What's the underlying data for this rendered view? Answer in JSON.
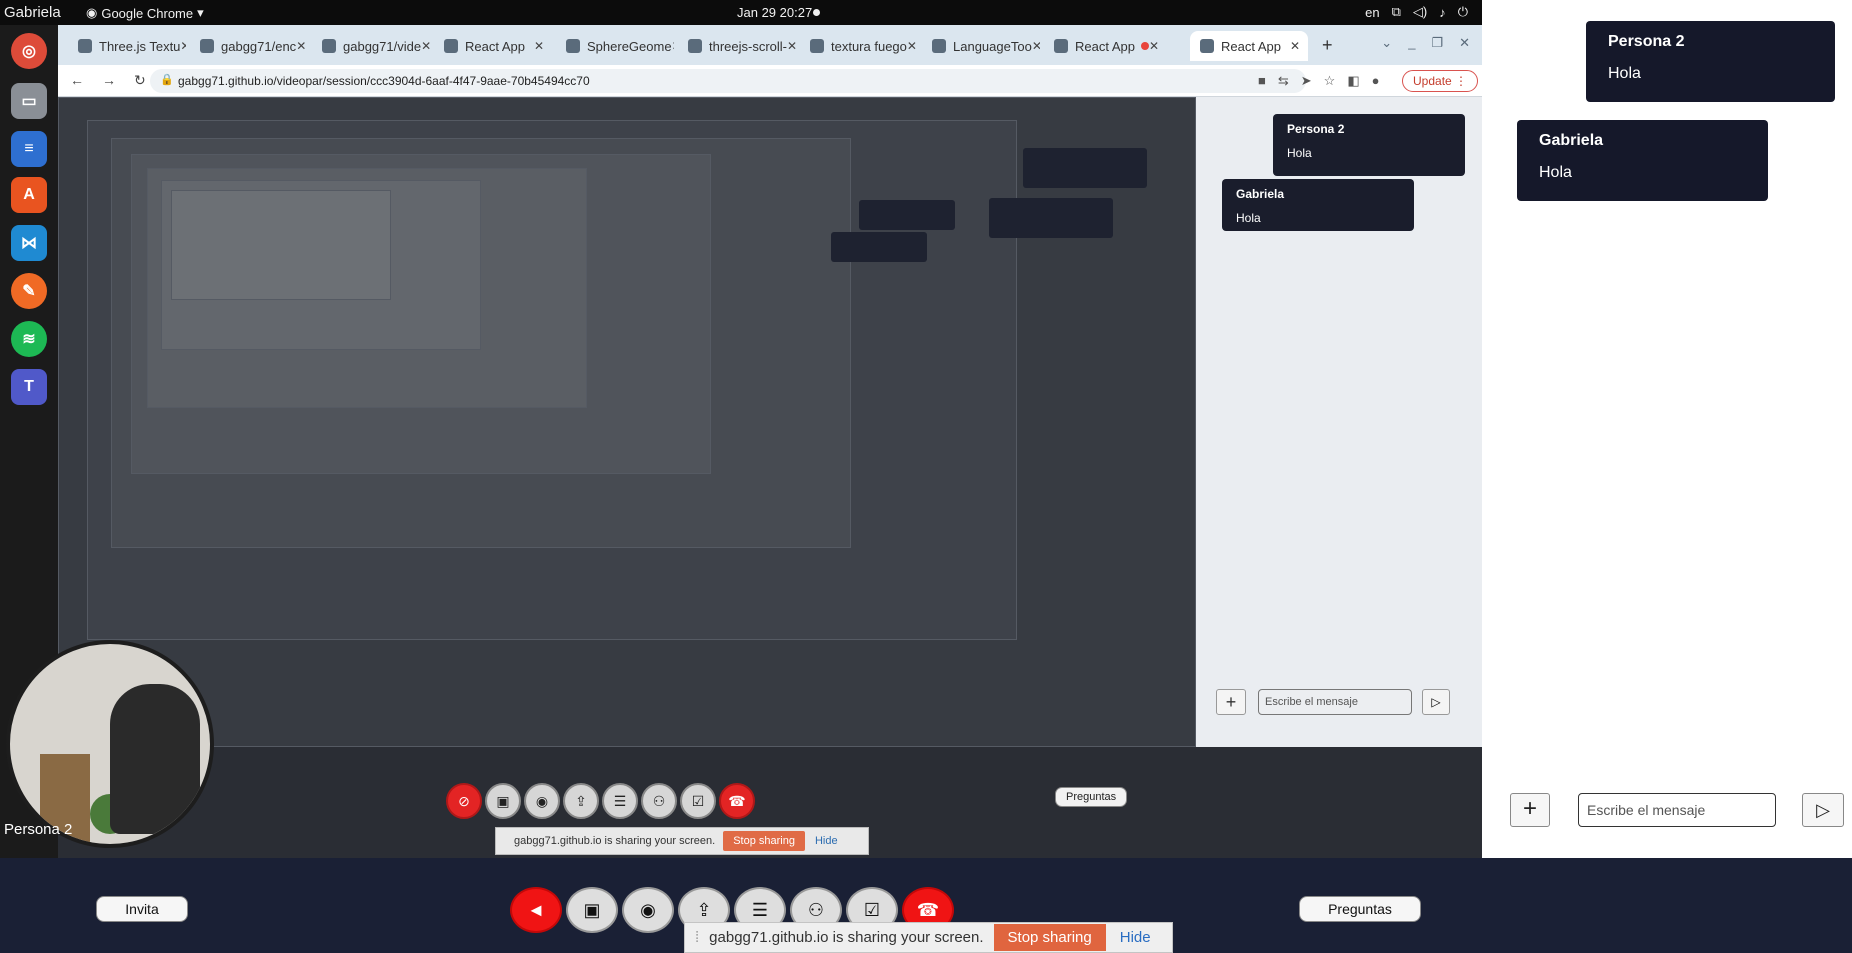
{
  "os_bar": {
    "user": "Gabriela",
    "app_menu": "Google Chrome",
    "clock": "Jan 29  20:27",
    "language": "en"
  },
  "dock": {
    "apps": [
      {
        "name": "chrome-icon",
        "color": "#dd4b39"
      },
      {
        "name": "files-icon",
        "color": "#8a8f96"
      },
      {
        "name": "document-icon",
        "color": "#2e6fd0"
      },
      {
        "name": "app-store-icon",
        "color": "#e95420"
      },
      {
        "name": "vscode-icon",
        "color": "#1f8ad2"
      },
      {
        "name": "drawing-icon",
        "color": "#f06a25"
      },
      {
        "name": "spotify-icon",
        "color": "#1db954"
      },
      {
        "name": "teams-icon",
        "color": "#5059c9"
      }
    ]
  },
  "browser": {
    "tabs": [
      {
        "label": "Three.js Textu"
      },
      {
        "label": "gabgg71/enc"
      },
      {
        "label": "gabgg71/vide"
      },
      {
        "label": "React App"
      },
      {
        "label": "SphereGeome"
      },
      {
        "label": "threejs-scroll-"
      },
      {
        "label": "textura fuego"
      },
      {
        "label": "LanguageToo"
      },
      {
        "label": "React App"
      },
      {
        "label": "React App"
      }
    ],
    "url": "gabgg71.github.io/videopar/session/ccc3904d-6aaf-4f47-9aae-70b45494cc70",
    "update_label": "Update"
  },
  "inner_page": {
    "chat_messages": [
      {
        "name": "Persona 2",
        "text": "Hola"
      },
      {
        "name": "Gabriela",
        "text": "Hola"
      }
    ],
    "input_placeholder": "Escribe el mensaje",
    "preguntas_label": "Preguntas",
    "share_text": "gabgg71.github.io is sharing your screen.",
    "stop_label": "Stop sharing",
    "hide_label": "Hide"
  },
  "camera": {
    "participant_name": "Persona 2"
  },
  "chat": {
    "messages": [
      {
        "name": "Persona 2",
        "text": "Hola"
      },
      {
        "name": "Gabriela",
        "text": "Hola"
      }
    ],
    "input_placeholder": "Escribe el mensaje",
    "plus_symbol": "+",
    "send_symbol": "▷"
  },
  "toolbar": {
    "invite_label": "Invita",
    "preguntas_label": "Preguntas",
    "controls": [
      {
        "name": "mute-button",
        "icon": "microphone-off-icon",
        "red": true
      },
      {
        "name": "camera-button",
        "icon": "video-camera-icon",
        "red": false
      },
      {
        "name": "record-button",
        "icon": "record-icon",
        "red": false
      },
      {
        "name": "share-screen-button",
        "icon": "screen-share-icon",
        "red": false
      },
      {
        "name": "chat-button",
        "icon": "chat-icon",
        "red": false
      },
      {
        "name": "participants-button",
        "icon": "people-icon",
        "red": false
      },
      {
        "name": "poll-button",
        "icon": "checklist-icon",
        "red": false
      },
      {
        "name": "hang-up-button",
        "icon": "phone-hangup-icon",
        "red": true
      }
    ]
  },
  "share_notice": {
    "text": "gabgg71.github.io is sharing your screen.",
    "stop_label": "Stop sharing",
    "hide_label": "Hide"
  },
  "colors": {
    "accent_red": "#f01414",
    "chat_bubble": "#15182a",
    "toolbar_bg": "#1a2035",
    "stop_button": "#e0653f"
  }
}
